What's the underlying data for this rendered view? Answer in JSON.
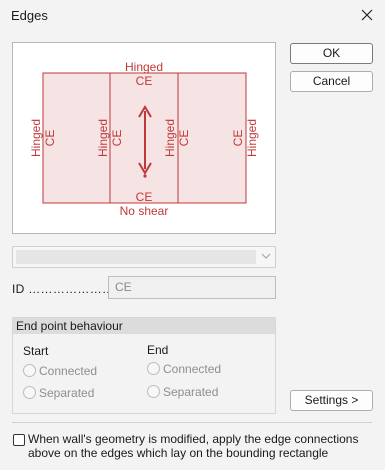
{
  "window": {
    "title": "Edges"
  },
  "buttons": {
    "ok": "OK",
    "cancel": "Cancel",
    "settings": "Settings >"
  },
  "preview": {
    "top_label": "Hinged",
    "top_ce": "CE",
    "bottom_ce": "CE",
    "bottom_label": "No shear",
    "left_outer": "Hinged",
    "left_ce": "CE",
    "mid1_hinged": "Hinged",
    "mid1_ce": "CE",
    "mid2_hinged": "Hinged",
    "mid2_ce": "CE",
    "right_ce": "CE",
    "right_outer": "Hinged",
    "accent": "#c0393b",
    "fill": "#f6e3e3"
  },
  "combo": {
    "value": ""
  },
  "id": {
    "label": "ID ………………….",
    "value": "CE"
  },
  "end_point": {
    "title": "End point behaviour",
    "start_label": "Start",
    "end_label": "End",
    "connected": "Connected",
    "separated": "Separated"
  },
  "checkbox": {
    "label": "When wall's geometry is modified, apply the edge connections above on the edges which lay on the bounding rectangle",
    "checked": false
  }
}
